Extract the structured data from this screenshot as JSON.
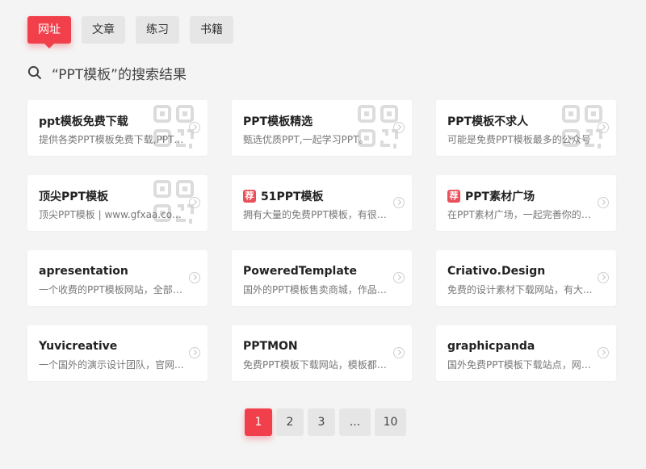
{
  "tabs": [
    {
      "label": "网址",
      "active": true
    },
    {
      "label": "文章",
      "active": false
    },
    {
      "label": "练习",
      "active": false
    },
    {
      "label": "书籍",
      "active": false
    }
  ],
  "search": {
    "icon": "search-icon",
    "title": "“PPT模板”的搜索结果"
  },
  "cards": [
    {
      "title": "ppt模板免费下载",
      "desc": "提供各类PPT模板免费下载,PPT背景",
      "badge": "",
      "qr": true
    },
    {
      "title": "PPT模板精选",
      "desc": "甄选优质PPT,一起学习PPT。",
      "badge": "",
      "qr": true
    },
    {
      "title": "PPT模板不求人",
      "desc": "可能是免费PPT模板最多的公众号",
      "badge": "",
      "qr": true
    },
    {
      "title": "顶尖PPT模板",
      "desc": "顶尖PPT模板 | www.gfxaa.com ...",
      "badge": "",
      "qr": true
    },
    {
      "title": "51PPT模板",
      "desc": "拥有大量的免费PPT模板，有很多...",
      "badge": "荐",
      "qr": false
    },
    {
      "title": "PPT素材广场",
      "desc": "在PPT素材广场，一起完善你的P...",
      "badge": "荐",
      "qr": false
    },
    {
      "title": "apresentation",
      "desc": "一个收费的PPT模板网站，全部都...",
      "badge": "",
      "qr": false
    },
    {
      "title": "PoweredTemplate",
      "desc": "国外的PPT模板售卖商城，作品质...",
      "badge": "",
      "qr": false
    },
    {
      "title": "Criativo.Design",
      "desc": "免费的设计素材下载网站，有大...",
      "badge": "",
      "qr": false
    },
    {
      "title": "Yuvicreative",
      "desc": "一个国外的演示设计团队，官网...",
      "badge": "",
      "qr": false
    },
    {
      "title": "PPTMON",
      "desc": "免费PPT模板下载网站，模板都比...",
      "badge": "",
      "qr": false
    },
    {
      "title": "graphicpanda",
      "desc": "国外免费PPT模板下载站点，网站...",
      "badge": "",
      "qr": false
    }
  ],
  "pagination": [
    {
      "label": "1",
      "active": true
    },
    {
      "label": "2",
      "active": false
    },
    {
      "label": "3",
      "active": false
    },
    {
      "label": "...",
      "active": false
    },
    {
      "label": "10",
      "active": false
    }
  ],
  "colors": {
    "accent": "#f1404b",
    "badge": "#e9505a",
    "background": "#f4f4f4"
  }
}
